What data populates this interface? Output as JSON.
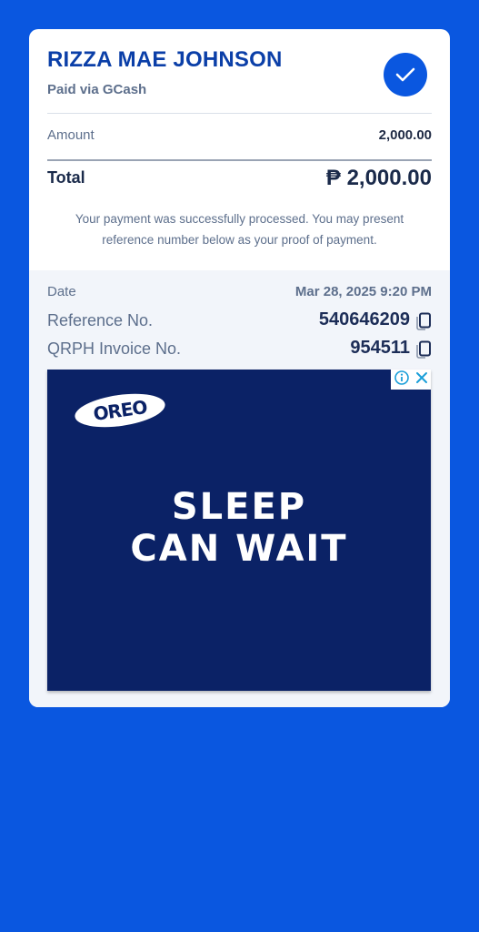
{
  "receipt": {
    "recipient_name": "RIZZA MAE JOHNSON",
    "payment_method": "Paid via GCash",
    "amount_label": "Amount",
    "amount_value": "2,000.00",
    "total_label": "Total",
    "total_value": "₱ 2,000.00",
    "notice": "Your payment was successfully processed. You may present reference number below as your proof of payment."
  },
  "details": {
    "date_label": "Date",
    "date_value": "Mar 28, 2025 9:20 PM",
    "reference_label": "Reference No.",
    "reference_value": "540646209",
    "invoice_label": "QRPH Invoice No.",
    "invoice_value": "954511"
  },
  "ad": {
    "brand": "OREO",
    "headline": "SLEEP CAN WAIT",
    "info_icon": "info-icon",
    "close_icon": "close-icon"
  },
  "colors": {
    "background": "#0a57e0",
    "accent": "#0b3fa8",
    "ad_background": "#0b2266"
  }
}
